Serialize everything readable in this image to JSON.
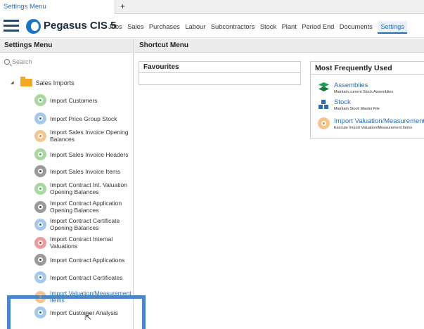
{
  "tab": {
    "title": "Settings Menu",
    "add_label": "+"
  },
  "app": {
    "brand": "Pegasus CIS 5"
  },
  "nav": [
    "Jobs",
    "Sales",
    "Purchases",
    "Labour",
    "Subcontractors",
    "Stock",
    "Plant",
    "Period End",
    "Documents",
    "Settings"
  ],
  "active_nav": "Settings",
  "left": {
    "header": "Settings Menu",
    "search_placeholder": "Search",
    "root": "Sales Imports",
    "items": [
      {
        "label": "Import Customers",
        "icon": "gear-green"
      },
      {
        "label": "Import Price Group Stock",
        "icon": "gear-blue"
      },
      {
        "label": "Import Sales Invoice Opening Balances",
        "icon": "gear-orange"
      },
      {
        "label": "Import Sales Invoice Headers",
        "icon": "gear-green"
      },
      {
        "label": "Import Sales Invoice Items",
        "icon": "gear-grey"
      },
      {
        "label": "Import Contract Int. Valuation Opening Balances",
        "icon": "gear-green"
      },
      {
        "label": "Import Contract Application Opening Balances",
        "icon": "gear-grey"
      },
      {
        "label": "Import Contract Certificate Opening Balances",
        "icon": "gear-blue"
      },
      {
        "label": "Import Contract Internal Valuations",
        "icon": "gear-red"
      },
      {
        "label": "Import Contract Applications",
        "icon": "gear-grey"
      },
      {
        "label": "Import Contract Certificates",
        "icon": "gear-blue"
      },
      {
        "label": "Import Valuation/Measurement Items",
        "icon": "gear-orange"
      },
      {
        "label": "Import Customer Analysis",
        "icon": "gear-blue"
      }
    ]
  },
  "right": {
    "header": "Shortcut Menu",
    "favourites_title": "Favourites",
    "mfu_title": "Most Frequently Used",
    "mfu": [
      {
        "title": "Assemblies",
        "sub": "Maintain current Stock Assemblies",
        "icon": "layers-icon"
      },
      {
        "title": "Stock",
        "sub": "Maintain Stock Master File",
        "icon": "boxes-icon"
      },
      {
        "title": "Import Valuation/Measurement",
        "sub": "Execute Import Valuation/Measurement Items",
        "icon": "gear-orange"
      }
    ]
  },
  "colors": {
    "accent": "#2b6cb0",
    "highlight_border": "#4a86c8"
  }
}
